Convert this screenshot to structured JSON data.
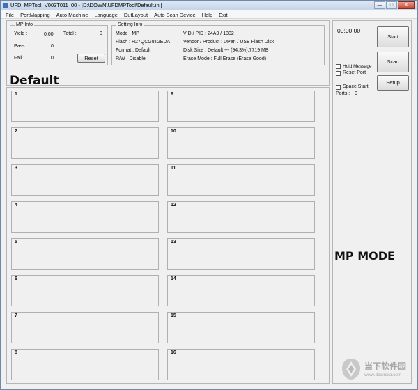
{
  "window": {
    "title": "UFD_MPTool_V003T011_00 - [D:\\DOWN\\UFDMPTool\\Default.ini]",
    "controls": {
      "minimize": "—",
      "maximize": "□",
      "close": "✕"
    }
  },
  "menu": [
    "File",
    "PortMapping",
    "Auto Machine",
    "Language",
    "DutLayout",
    "Auto Scan Device",
    "Help",
    "Exit"
  ],
  "mp_info": {
    "legend": "MP Info",
    "yield_label": "Yield :",
    "yield_value": "0.00",
    "total_label": "Total :",
    "total_value": "0",
    "pass_label": "Pass :",
    "pass_value": "0",
    "fail_label": "Fail :",
    "fail_value": "0",
    "reset_label": "Reset"
  },
  "setting_info": {
    "legend": "Setting Info",
    "mode": "Mode : MP",
    "flash": "Flash : H27QCG8T2EDA",
    "format": "Format : Default",
    "rw": "R/W : Disable",
    "vid_pid": "VID / PID : 24A9 / 1302",
    "vendor_product": "Vendor / Product : UPen / USB Flash Disk",
    "disk_size": "Disk Size : Default --- (94.3%),7719 MB",
    "erase_mode": "Erase Mode : Full Erase (Erase Good)"
  },
  "overlay_default": "Default",
  "overlay_mode": "MP MODE",
  "slots": [
    "1",
    "2",
    "3",
    "4",
    "5",
    "6",
    "7",
    "8",
    "9",
    "10",
    "11",
    "12",
    "13",
    "14",
    "15",
    "16"
  ],
  "right_panel": {
    "timer": "00:00:00",
    "start_label": "Start",
    "scan_label": "Scan",
    "setup_label": "Setup",
    "hold_message": "Hold Message",
    "reset_port": "Reset Port",
    "space_start": "Space Start",
    "ports_label": "Ports :",
    "ports_value": "0"
  },
  "watermark": {
    "text": "当下软件园",
    "url": "www.downxia.com"
  }
}
